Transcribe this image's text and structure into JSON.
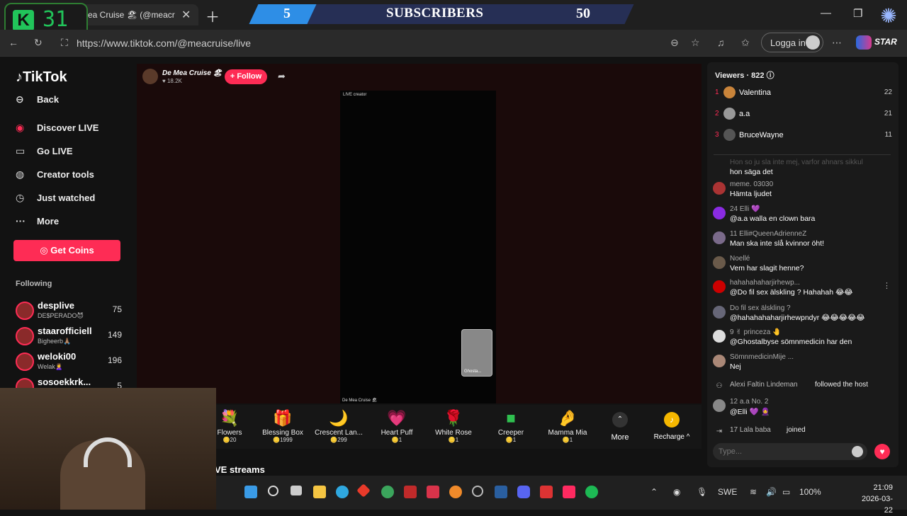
{
  "overlay": {
    "k_counter": "31",
    "subscribers_current": "5",
    "subscribers_label": "SUBSCRIBERS",
    "subscribers_goal": "50"
  },
  "browser": {
    "tab_title": "ea Cruise 🏖 (@meacr",
    "url": "https://www.tiktok.com/@meacruise/live",
    "login_label": "Logga in",
    "star_label": "STAR"
  },
  "sidebar": {
    "logo": "TikTok",
    "nav": [
      {
        "label": "Back",
        "icon": "arrow-left-icon"
      },
      {
        "label": "Discover LIVE",
        "icon": "live-icon"
      },
      {
        "label": "Go LIVE",
        "icon": "camera-icon"
      },
      {
        "label": "Creator tools",
        "icon": "lightbulb-icon"
      },
      {
        "label": "Just watched",
        "icon": "history-icon"
      },
      {
        "label": "More",
        "icon": "more-icon"
      }
    ],
    "coins_label": "Get Coins",
    "following_header": "Following",
    "following": [
      {
        "name": "desplive",
        "sub": "DE$PERADO😈",
        "count": "75"
      },
      {
        "name": "staarofficiell",
        "sub": "Bigheerb🙏🏽",
        "count": "149"
      },
      {
        "name": "weloki00",
        "sub": "Welak🙎‍♀️",
        "count": "196"
      },
      {
        "name": "sosoekkrk...",
        "sub": "",
        "count": "5"
      }
    ]
  },
  "stream": {
    "host_name": "De Mea Cruise 🏖",
    "host_likes": "♥ 18.2K",
    "follow_label": "+ Follow",
    "video_label": "LIVE creator",
    "video_name": "De Mea Cruise 🏖",
    "guest_label": "Ghosta...",
    "live_streams_label": "VE streams"
  },
  "gifts": [
    {
      "name": "Flowers",
      "price": "🪙20",
      "icon": "💐"
    },
    {
      "name": "Blessing Box",
      "price": "🪙1999",
      "icon": "🎁"
    },
    {
      "name": "Crescent Lan...",
      "price": "🪙299",
      "icon": "🌙"
    },
    {
      "name": "Heart Puff",
      "price": "🪙1",
      "icon": "💗"
    },
    {
      "name": "White Rose",
      "price": "🪙1",
      "icon": "🌹"
    },
    {
      "name": "Creeper",
      "price": "🪙1",
      "icon": "🟩"
    },
    {
      "name": "Mamma Mia",
      "price": "🪙1",
      "icon": "🤌"
    }
  ],
  "gift_more_label": "More",
  "recharge_label": "Recharge ^",
  "chat": {
    "viewers_label": "Viewers · 822 ⓘ",
    "top_viewers": [
      {
        "rank": "1",
        "name": "Valentina",
        "score": "22",
        "color": "#c9843a"
      },
      {
        "rank": "2",
        "name": "a.a",
        "score": "21",
        "color": "#999999"
      },
      {
        "rank": "3",
        "name": "BruceWayne",
        "score": "11",
        "color": "#555555"
      }
    ],
    "messages": [
      {
        "user": "Hon so ju sla inte mej, varfor ahnars sikkul",
        "text": "hon säga det"
      },
      {
        "user": "meme. 03030",
        "text": "Hämta ljudet"
      },
      {
        "user": "24 Elli 💜",
        "text": "@a.a walla en clown bara"
      },
      {
        "user": "11 Elli#QueenAdrienneZ",
        "text": "Man ska inte slå kvinnor öht!"
      },
      {
        "user": "Noellé",
        "text": "Vem har slagit henne?"
      },
      {
        "user": "hahahahaharjirhewp...",
        "text": "@Do fil sex älskling ? Hahahah 😂😂"
      },
      {
        "user": "Do fil sex älskling ?",
        "text": "@hahahahaharjirhewpndyr 😂😂😂😂😂"
      },
      {
        "user": "9 ✌ princeza 🤚",
        "text": "@Ghostalbyse sömnmedicin har den"
      },
      {
        "user": "SömnmedicinMije ...",
        "text": "Nej"
      },
      {
        "user": "Alexi Faltin Lindeman",
        "text": "followed the host"
      },
      {
        "user": "12 a.a No. 2",
        "text": "@Elli 💜 🧕"
      },
      {
        "user": "17 Lala baba",
        "text": "joined"
      }
    ],
    "input_placeholder": "Type..."
  },
  "taskbar": {
    "lang": "SWE",
    "battery": "100%",
    "time": "21:09",
    "date": "2026-03-22"
  }
}
